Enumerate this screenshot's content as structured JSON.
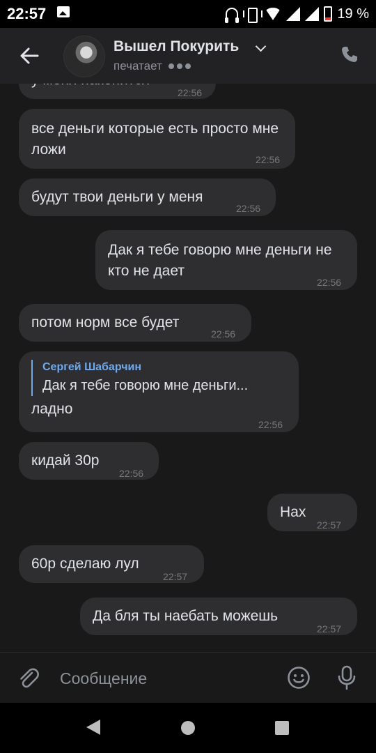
{
  "status_bar": {
    "time": "22:57",
    "battery": "19 %",
    "icons": [
      "gallery-icon",
      "headset-icon",
      "vibrate-icon",
      "wifi-icon",
      "signal-icon",
      "signal-icon",
      "battery-icon"
    ]
  },
  "header": {
    "chat_name": "Вышел Покурить",
    "status": "печатает",
    "icons": [
      "back-arrow-icon",
      "chevron-down-icon",
      "call-icon"
    ]
  },
  "messages": [
    {
      "dir": "in",
      "text": "у меня накопится",
      "time": "22:56",
      "partial": true
    },
    {
      "dir": "in",
      "text": "все деньги которые есть просто мне ложи",
      "time": "22:56"
    },
    {
      "dir": "in",
      "text": "будут твои деньги у меня",
      "time": "22:56"
    },
    {
      "dir": "out",
      "text": "Дак я тебе говорю мне деньги не кто не дает",
      "time": "22:56"
    },
    {
      "dir": "in",
      "text": "потом норм все будет",
      "time": "22:56"
    },
    {
      "dir": "in",
      "reply_author": "Сергей Шабарчин",
      "reply_text": "Дак я тебе говорю мне деньги...",
      "text": "ладно",
      "time": "22:56"
    },
    {
      "dir": "in",
      "text": "кидай 30р",
      "time": "22:56"
    },
    {
      "dir": "out",
      "text": "Нах",
      "time": "22:57"
    },
    {
      "dir": "in",
      "text": "60р сделаю лул",
      "time": "22:57"
    },
    {
      "dir": "out",
      "text": "Да бля ты наебать можешь",
      "time": "22:57"
    }
  ],
  "composer": {
    "placeholder": "Сообщение",
    "icons": [
      "attach-icon",
      "emoji-icon",
      "microphone-icon"
    ]
  },
  "nav": {
    "icons": [
      "nav-back-icon",
      "nav-home-icon",
      "nav-recents-icon"
    ]
  },
  "colors": {
    "background": "#19191a",
    "bubble": "#2e2e30",
    "header": "#222224",
    "accent_link": "#71aaeb",
    "muted": "#8d9199"
  }
}
